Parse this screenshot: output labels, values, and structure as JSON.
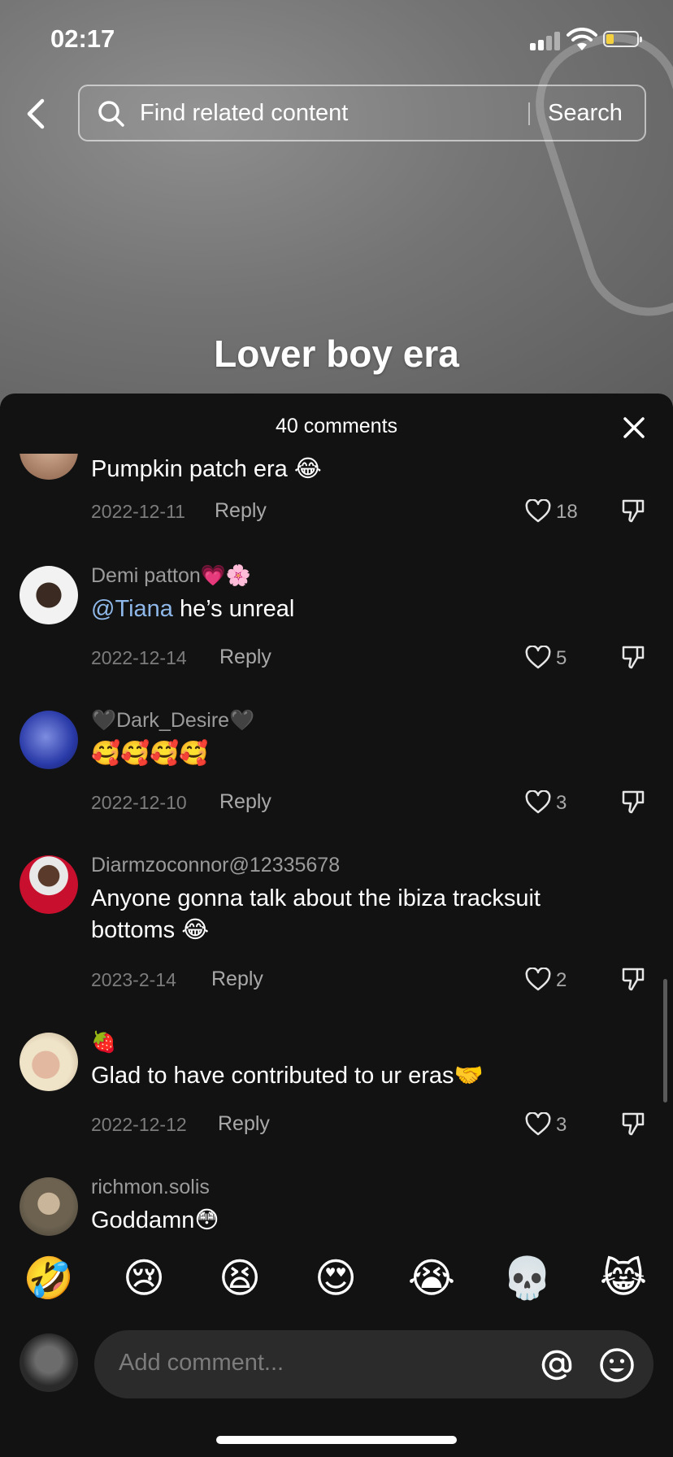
{
  "status_bar": {
    "time": "02:17"
  },
  "search": {
    "placeholder": "Find related content",
    "button_label": "Search"
  },
  "video": {
    "caption": "Lover boy era"
  },
  "comments_panel": {
    "title": "40 comments",
    "reply_label": "Reply",
    "comments": [
      {
        "username": "",
        "text": "Pumpkin patch era 😂",
        "date": "2022-12-11",
        "likes": "18"
      },
      {
        "username": "Demi patton💗🌸",
        "mention": "@Tiana",
        "text": " he’s unreal",
        "date": "2022-12-14",
        "likes": "5"
      },
      {
        "username": "🖤Dark_Desire🖤",
        "text": "🥰🥰🥰🥰",
        "date": "2022-12-10",
        "likes": "3"
      },
      {
        "username": "Diarmzoconnor@12335678",
        "text": "Anyone gonna talk about the ibiza tracksuit bottoms 😂",
        "date": "2023-2-14",
        "likes": "2"
      },
      {
        "username": "🍓",
        "text": "Glad to have contributed to ur eras🤝",
        "date": "2022-12-12",
        "likes": "3"
      },
      {
        "username": "richmon.solis",
        "text": "Goddamn😳",
        "date": "",
        "likes": ""
      }
    ]
  },
  "quick_emojis": [
    "🤣",
    "😢",
    "😫",
    "😍",
    "😭",
    "💀",
    "😹"
  ],
  "composer": {
    "placeholder": "Add comment..."
  },
  "colors": {
    "panel_bg": "#121212",
    "mention": "#8fb8ea",
    "input_bg": "#2b2b2b"
  }
}
